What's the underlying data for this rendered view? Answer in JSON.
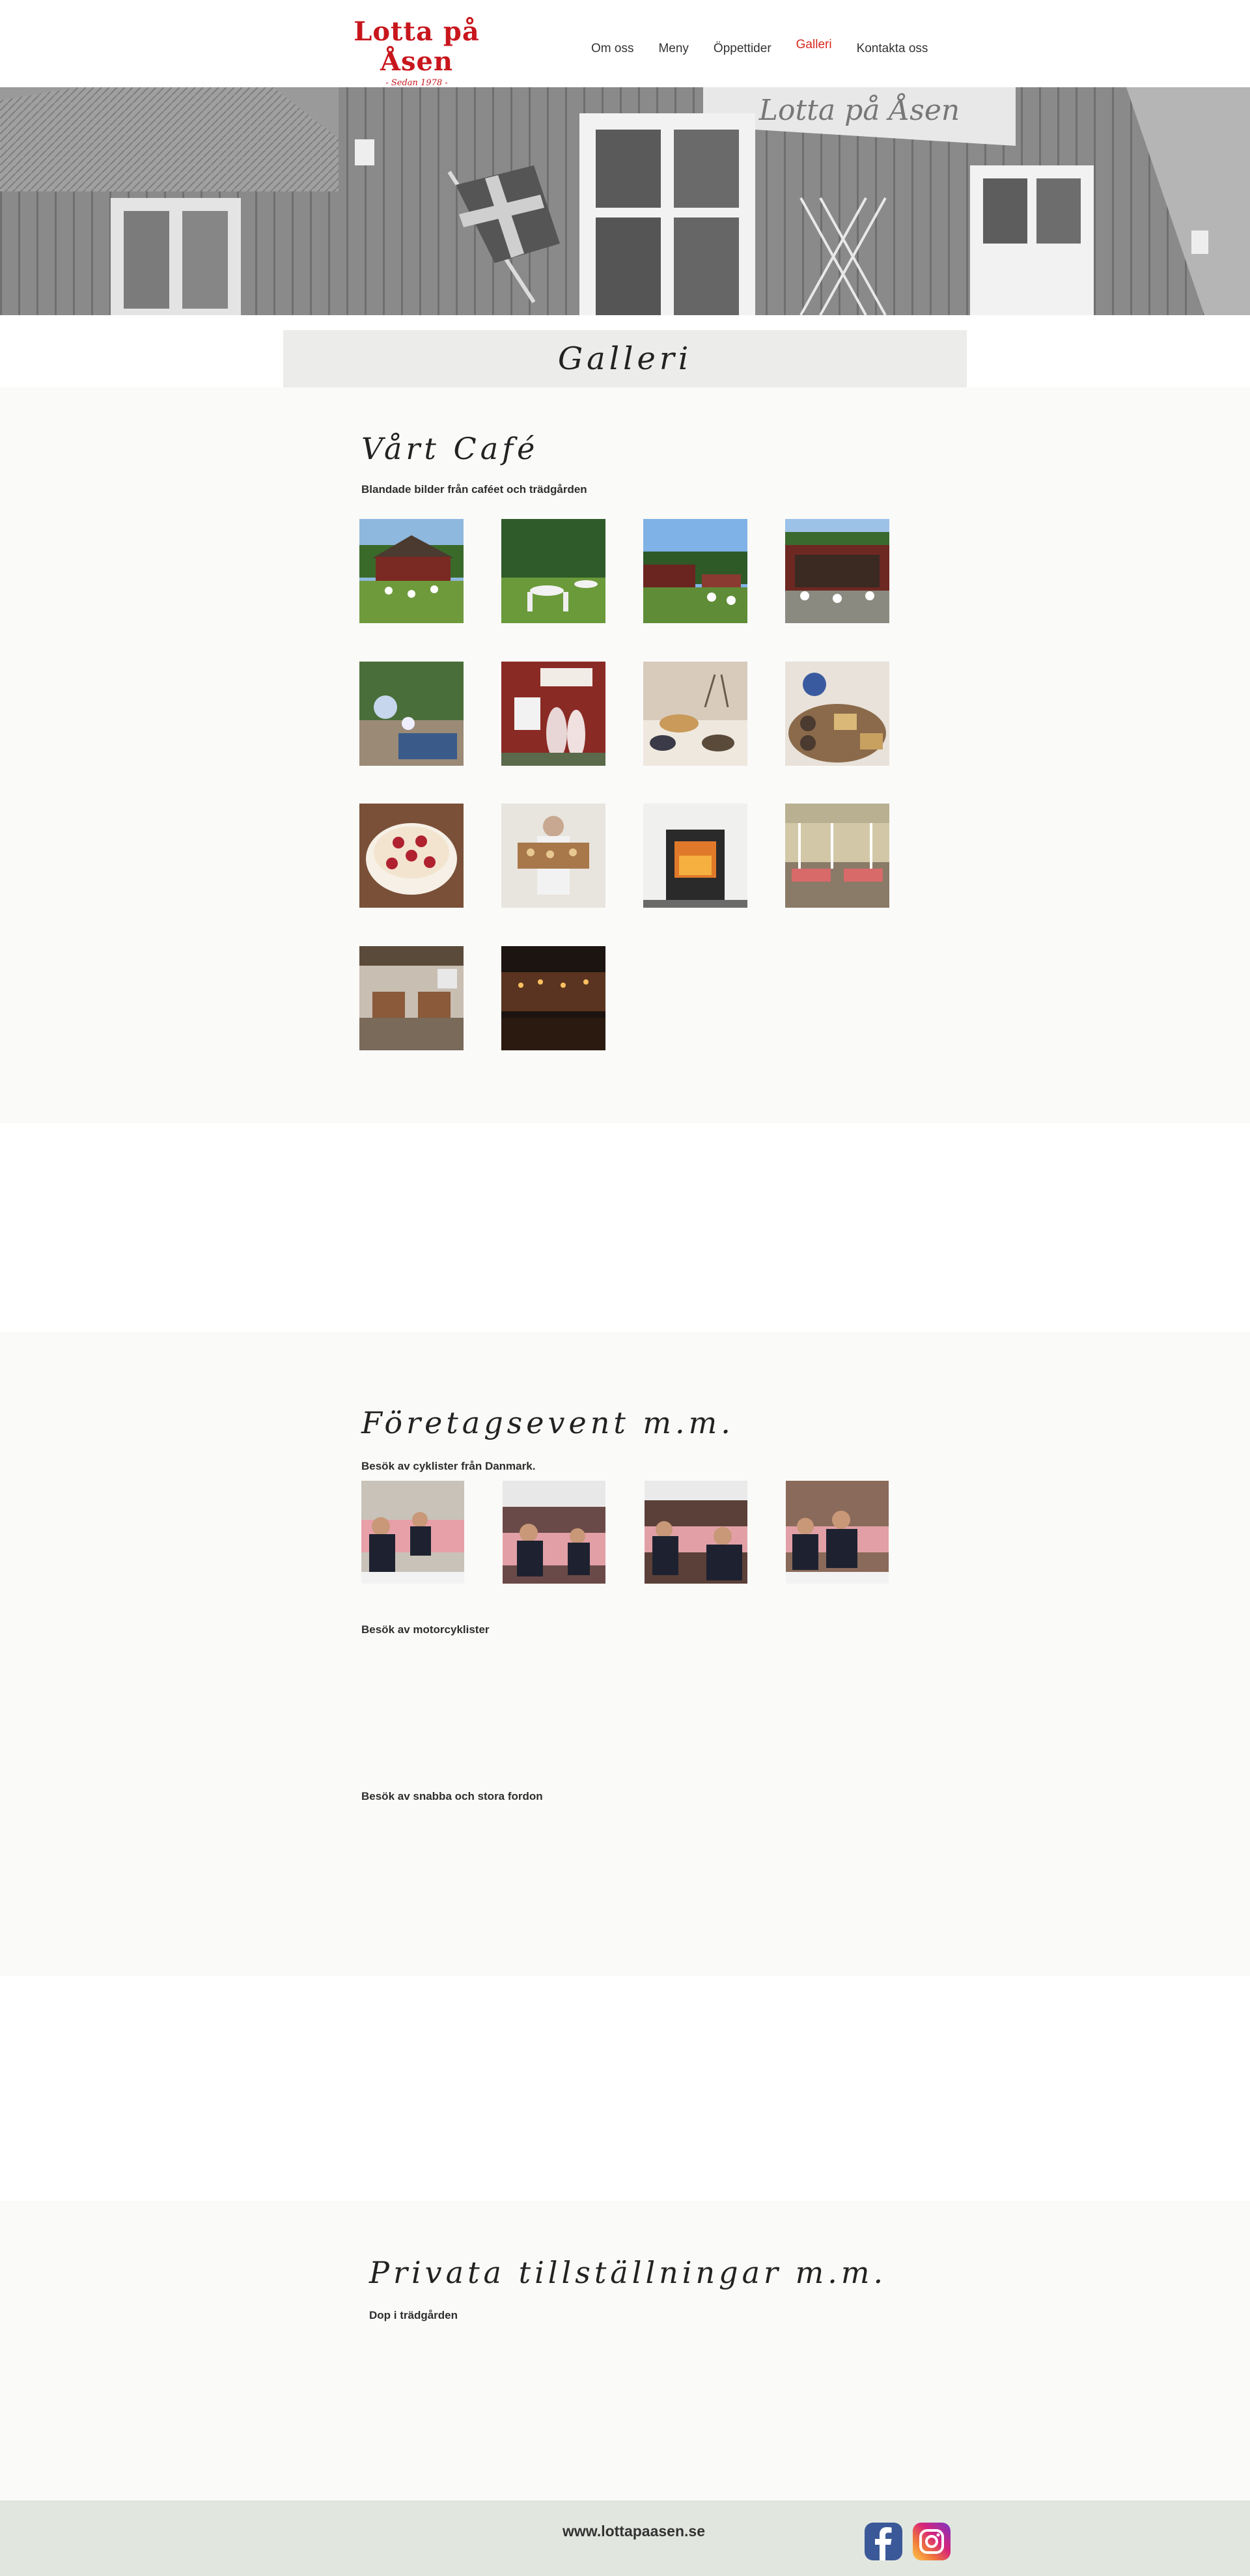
{
  "header": {
    "logo_title": "Lotta på Åsen",
    "logo_subtitle": "- Sedan 1978 -",
    "nav": [
      "Om oss",
      "Meny",
      "Öppettider",
      "Galleri",
      "Kontakta oss"
    ],
    "active_nav": "Galleri",
    "accent_color": "#d9271f"
  },
  "hero": {
    "sign_text": "Lotta på Åsen"
  },
  "page_title": "Galleri",
  "sections": {
    "cafe": {
      "title": "Vårt Café",
      "description": "Blandade bilder från caféet och trädgården",
      "photo_count": 14
    },
    "corporate": {
      "title": "Företagsevent m.m.",
      "cyclists_caption": "Besök av cyklister från Danmark.",
      "cyclists_photo_count": 4,
      "motorcyclists_caption": "Besök av motorcyklister",
      "vehicles_caption": "Besök av snabba och stora fordon"
    },
    "private": {
      "title": "Privata tillställningar m.m.",
      "caption": "Dop i trädgården"
    }
  },
  "footer": {
    "url": "www.lottapaasen.se",
    "social_icons": [
      "facebook-icon",
      "instagram-icon"
    ]
  }
}
